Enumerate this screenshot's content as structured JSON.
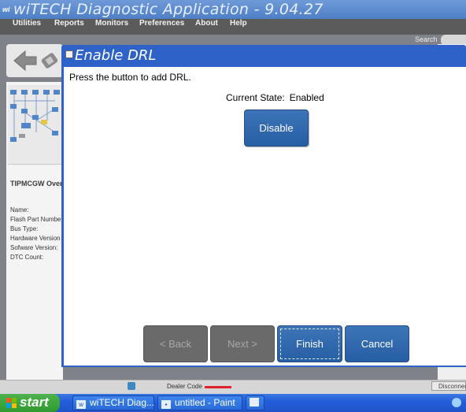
{
  "app": {
    "logo_text": "wi",
    "title": "wiTECH Diagnostic Application - 9.04.27"
  },
  "menu": {
    "items": [
      "Utilities",
      "Reports",
      "Monitors",
      "Preferences",
      "About",
      "Help"
    ]
  },
  "header": {
    "search_label": "Search"
  },
  "left_panel": {
    "module_title": "TIPMCGW Over",
    "labels": [
      "Name:",
      "Flash Part Numbe",
      "Bus Type:",
      "Hardware Version",
      "Sofware Version:",
      "DTC Count:"
    ]
  },
  "status_bar": {
    "dealer_code_label": "Dealer Code",
    "disconnect_label": "Disconnect"
  },
  "taskbar": {
    "start_label": "start",
    "tasks": [
      "wiTECH Diag...",
      "untitled - Paint"
    ]
  },
  "dialog": {
    "title": "Enable DRL",
    "instructions": "Press the button to add DRL.",
    "state_label": "Current State:",
    "state_value": "Enabled",
    "action_button": "Disable",
    "back_button": "< Back",
    "next_button": "Next >",
    "finish_button": "Finish",
    "cancel_button": "Cancel"
  },
  "colors": {
    "title_bar": "#4e7fc6",
    "menu_bar": "#5b5b5b",
    "button_blue": "#3067ad",
    "button_disabled": "#6a6a6a",
    "dialog_frame": "#2f62c8"
  }
}
